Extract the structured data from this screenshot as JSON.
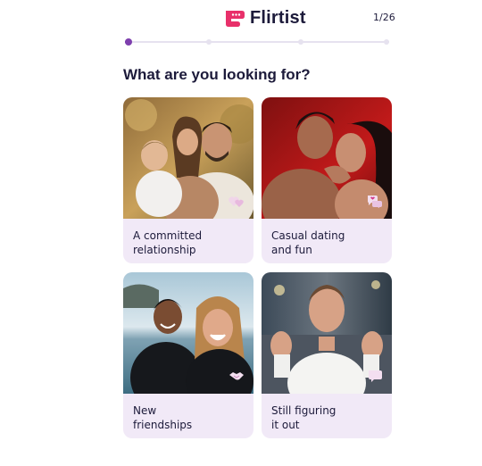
{
  "app": {
    "name": "Flirtist",
    "brand_color": "#e8306a",
    "accent": "#7e3fae",
    "text_color": "#1c1a3a"
  },
  "progress": {
    "step_label": "1/26",
    "current_step": 1,
    "total_steps": 26,
    "visible_dots": 4
  },
  "question": "What are you looking for?",
  "options": [
    {
      "label": "A committed relationship",
      "icon": "hearts-icon"
    },
    {
      "label": "Casual dating and fun",
      "icon": "chat-heart-icon"
    },
    {
      "label": "New friendships",
      "icon": "handshake-icon"
    },
    {
      "label": "Still figuring it out",
      "icon": "question-bubble-icon"
    }
  ]
}
